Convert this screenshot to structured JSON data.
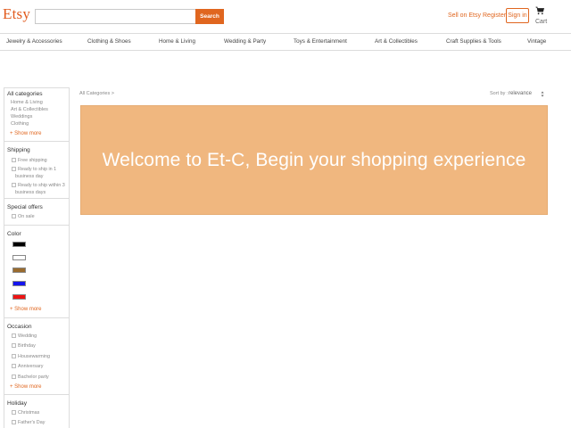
{
  "header": {
    "logo": "Etsy",
    "search": {
      "value": "",
      "placeholder": ""
    },
    "search_button": "Search",
    "sell_link": "Sell on Etsy",
    "register_link": "Register",
    "signin_button": "Sign in",
    "cart_label": "Cart",
    "cart_icon": "cart-icon"
  },
  "categories": [
    "Jewelry & Accessories",
    "Clothing & Shoes",
    "Home & Living",
    "Wedding & Party",
    "Toys & Entertainment",
    "Art & Collectibles",
    "Craft Supplies & Tools",
    "Vintage"
  ],
  "sidebar": {
    "all_categories": {
      "title": "All categories",
      "links": [
        "Home & Living",
        "Art & Collectibles",
        "Weddings",
        "Clothing"
      ],
      "show_more": "+ Show more"
    },
    "shipping": {
      "title": "Shipping",
      "options": [
        "Free shipping",
        "Ready to ship in 1 business day",
        "Ready to ship within 3 business days"
      ]
    },
    "special_offers": {
      "title": "Special offers",
      "options": [
        "On sale"
      ]
    },
    "color": {
      "title": "Color",
      "swatches": [
        "#000000",
        "#ffffff",
        "#9a6b2e",
        "#1414ee",
        "#ee1414"
      ],
      "show_more": "+ Show more"
    },
    "occasion": {
      "title": "Occasion",
      "options": [
        "Wedding",
        "Birthday",
        "Housewarming",
        "Anniversary",
        "Bachelor party"
      ],
      "show_more": "+ Show more"
    },
    "holiday": {
      "title": "Holiday",
      "options": [
        "Christmas",
        "Father's Day"
      ]
    }
  },
  "main": {
    "breadcrumb": "All Categories >",
    "sort_label": "Sort by :",
    "sort_value": "relevance",
    "banner_text": "Welcome to Et-C, Begin your shopping experience"
  },
  "colors": {
    "accent": "#e0661f",
    "banner": "#f0b77f"
  }
}
